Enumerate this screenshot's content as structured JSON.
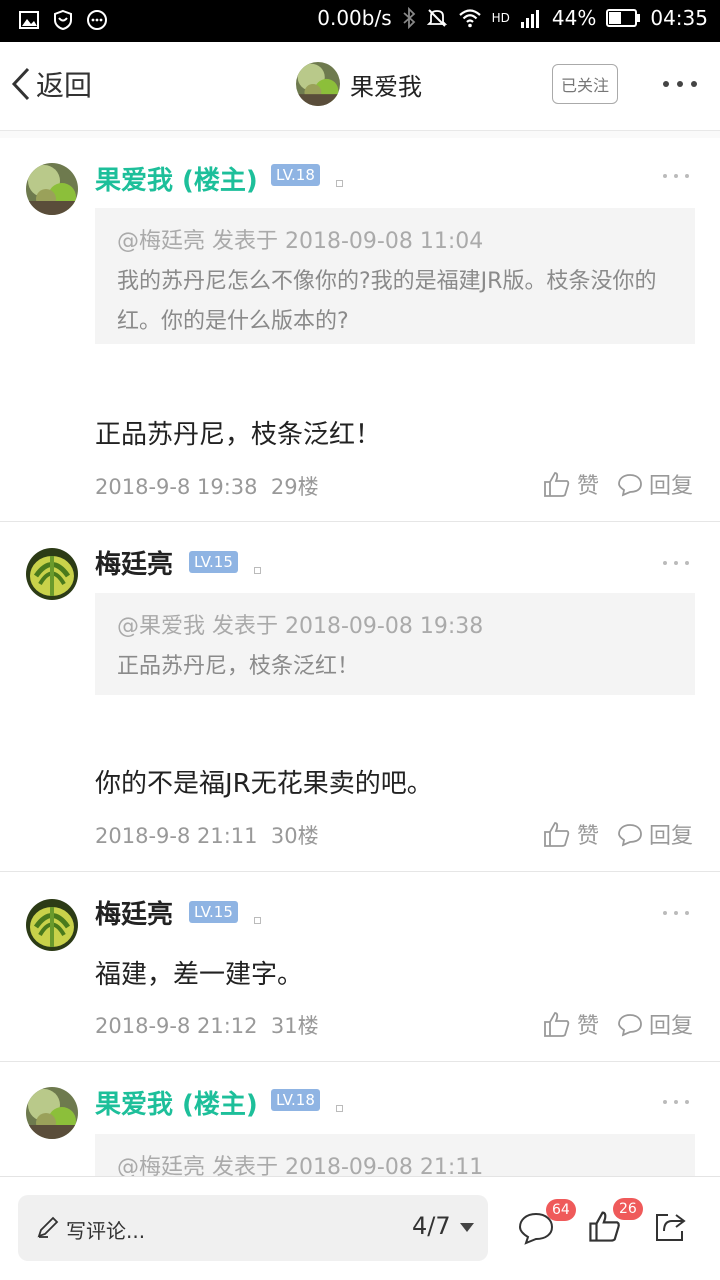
{
  "status_bar": {
    "net_speed": "0.00b/s",
    "signal_label": "HD",
    "battery": "44%",
    "time": "04:35",
    "icons": [
      "image-icon",
      "shield-icon",
      "dots-circle-icon",
      "bluetooth-icon",
      "mute-icon",
      "wifi-icon",
      "signal-icon",
      "battery-icon"
    ]
  },
  "nav": {
    "back_label": "返回",
    "title": "果爱我",
    "follow_label": "已关注"
  },
  "posts": [
    {
      "username": "果爱我 (楼主)",
      "level": "LV.18",
      "quote_head": "@梅廷亮 发表于 2018-09-08 11:04",
      "quote_body": "我的苏丹尼怎么不像你的?我的是福建JR版。枝条没你的红。你的是什么版本的?",
      "text": "正品苏丹尼，枝条泛红！",
      "time": "2018-9-8 19:38",
      "floor": "29楼",
      "like_label": "赞",
      "reply_label": "回复"
    },
    {
      "username": "梅廷亮",
      "level": "LV.15",
      "quote_head": "@果爱我 发表于 2018-09-08 19:38",
      "quote_body": "正品苏丹尼，枝条泛红！",
      "text": "你的不是福JR无花果卖的吧。",
      "time": "2018-9-8 21:11",
      "floor": "30楼",
      "like_label": "赞",
      "reply_label": "回复"
    },
    {
      "username": "梅廷亮",
      "level": "LV.15",
      "text": "福建，差一建字。",
      "time": "2018-9-8 21:12",
      "floor": "31楼",
      "like_label": "赞",
      "reply_label": "回复"
    },
    {
      "username": "果爱我 (楼主)",
      "level": "LV.18",
      "quote_head": "@梅廷亮 发表于 2018-09-08 21:11"
    }
  ],
  "bottom": {
    "comment_placeholder": "写评论...",
    "page_indicator": "4/7",
    "comment_count": "64",
    "like_count": "26"
  },
  "colors": {
    "owner_name": "#1dbf9a",
    "level_badge": "#8fb4e3",
    "count_badge": "#ef5a5a"
  }
}
